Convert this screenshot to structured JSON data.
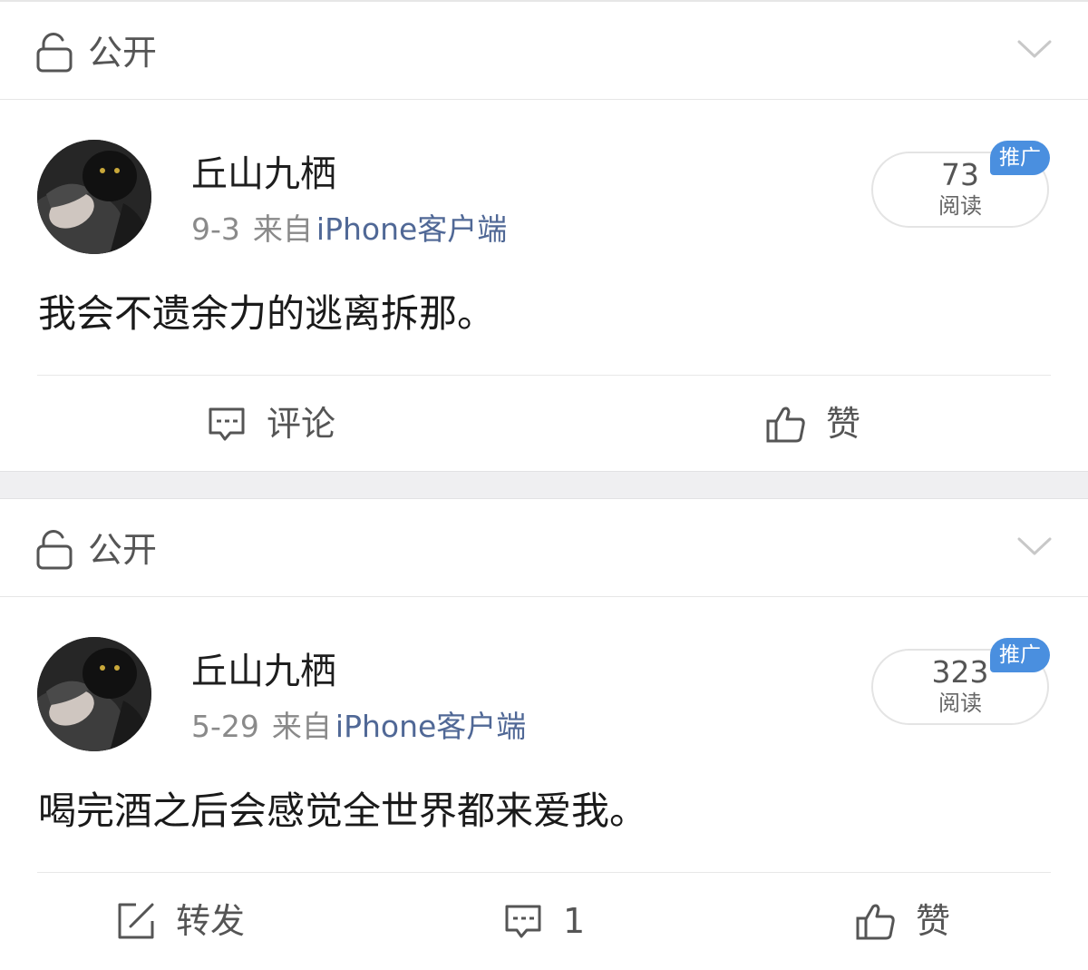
{
  "posts": [
    {
      "visibility": "公开",
      "username": "丘山九栖",
      "date": "9-3",
      "from_label": "来自",
      "client": "iPhone客户端",
      "reads": "73",
      "reads_label": "阅读",
      "promo_badge": "推广",
      "text": "我会不遗余力的逃离拆那。",
      "actions": {
        "comment_label": "评论",
        "like_label": "赞"
      }
    },
    {
      "visibility": "公开",
      "username": "丘山九栖",
      "date": "5-29",
      "from_label": "来自",
      "client": "iPhone客户端",
      "reads": "323",
      "reads_label": "阅读",
      "promo_badge": "推广",
      "text": "喝完酒之后会感觉全世界都来爱我。",
      "actions": {
        "repost_label": "转发",
        "comment_count": "1",
        "like_label": "赞"
      }
    }
  ],
  "colors": {
    "link_blue": "#506896",
    "badge_blue": "#4a8fdf",
    "separator_gray": "#efeff1",
    "icon_gray": "#555555"
  },
  "icons": [
    "lock-icon",
    "chevron-down-icon",
    "comment-icon",
    "thumbs-up-icon",
    "repost-icon"
  ]
}
